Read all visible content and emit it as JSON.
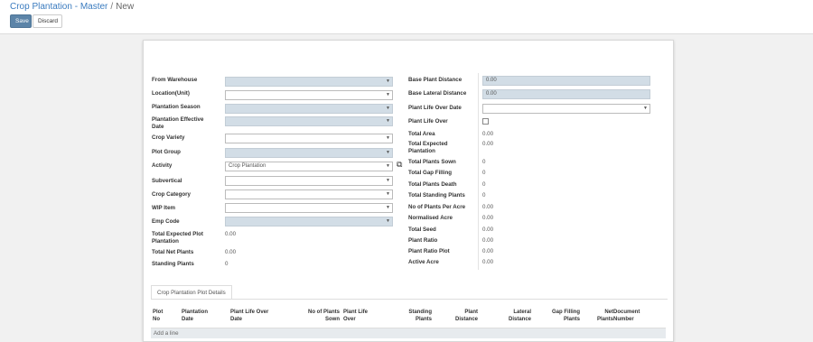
{
  "breadcrumb": {
    "root": "Crop Plantation - Master",
    "separator": "/",
    "current": "New"
  },
  "toolbar": {
    "save_label": "Save",
    "discard_label": "Discard"
  },
  "left_fields": {
    "from_warehouse": {
      "label": "From Warehouse",
      "value": ""
    },
    "location_unit": {
      "label": "Location(Unit)",
      "value": ""
    },
    "plantation_season": {
      "label": "Plantation Season",
      "value": ""
    },
    "plantation_effective_date": {
      "label": "Plantation Effective Date",
      "value": ""
    },
    "crop_variety": {
      "label": "Crop Variety",
      "value": ""
    },
    "plot_group": {
      "label": "Plot Group",
      "value": ""
    },
    "activity": {
      "label": "Activity",
      "value": "Crop Plantation"
    },
    "subvertical": {
      "label": "Subvertical",
      "value": ""
    },
    "crop_category": {
      "label": "Crop Category",
      "value": ""
    },
    "wip_item": {
      "label": "WIP Item",
      "value": ""
    },
    "emp_code": {
      "label": "Emp Code",
      "value": ""
    },
    "total_expected_plot_plantation": {
      "label": "Total Expected Plot Plantation",
      "value": "0.00"
    },
    "total_net_plants": {
      "label": "Total Net Plants",
      "value": "0.00"
    },
    "standing_plants": {
      "label": "Standing Plants",
      "value": "0"
    }
  },
  "right_fields": {
    "base_plant_distance": {
      "label": "Base Plant Distance",
      "value": "0.00"
    },
    "base_lateral_distance": {
      "label": "Base Lateral Distance",
      "value": "0.00"
    },
    "plant_life_over_date": {
      "label": "Plant Life Over Date",
      "value": ""
    },
    "plant_life_over": {
      "label": "Plant Life Over",
      "checked": false
    },
    "total_area": {
      "label": "Total Area",
      "value": "0.00"
    },
    "total_expected_plantation": {
      "label": "Total Expected Plantation",
      "value": "0.00"
    },
    "total_plants_sown": {
      "label": "Total Plants Sown",
      "value": "0"
    },
    "total_gap_filling": {
      "label": "Total Gap Filling",
      "value": "0"
    },
    "total_plants_death": {
      "label": "Total Plants Death",
      "value": "0"
    },
    "total_standing_plants": {
      "label": "Total Standing Plants",
      "value": "0"
    },
    "no_of_plants_per_acre": {
      "label": "No of Plants Per Acre",
      "value": "0.00"
    },
    "normalised_acre": {
      "label": "Normalised Acre",
      "value": "0.00"
    },
    "total_seed": {
      "label": "Total Seed",
      "value": "0.00"
    },
    "plant_ratio": {
      "label": "Plant Ratio",
      "value": "0.00"
    },
    "plant_ratio_plot": {
      "label": "Plant Ratio Plot",
      "value": "0.00"
    },
    "active_acre": {
      "label": "Active Acre",
      "value": "0.00"
    }
  },
  "tabs": [
    {
      "label": "Crop Plantation  Plot Details"
    }
  ],
  "table": {
    "columns": [
      "Plot No",
      "Plantation Date",
      "Plant Life Over Date",
      "No of Plants Sown",
      "Plant Life Over",
      "Standing Plants",
      "Plant Distance",
      "Lateral Distance",
      "Gap Filling Plants",
      "Net Plants",
      "Document Number"
    ],
    "add_line_label": "Add a line"
  },
  "icons": {
    "dropdown": "caret-down-icon",
    "external_link": "external-link-icon"
  },
  "colors": {
    "required_field_bg": "#d2dde6",
    "primary_button": "#5c84a8",
    "link": "#3a7bbf"
  }
}
